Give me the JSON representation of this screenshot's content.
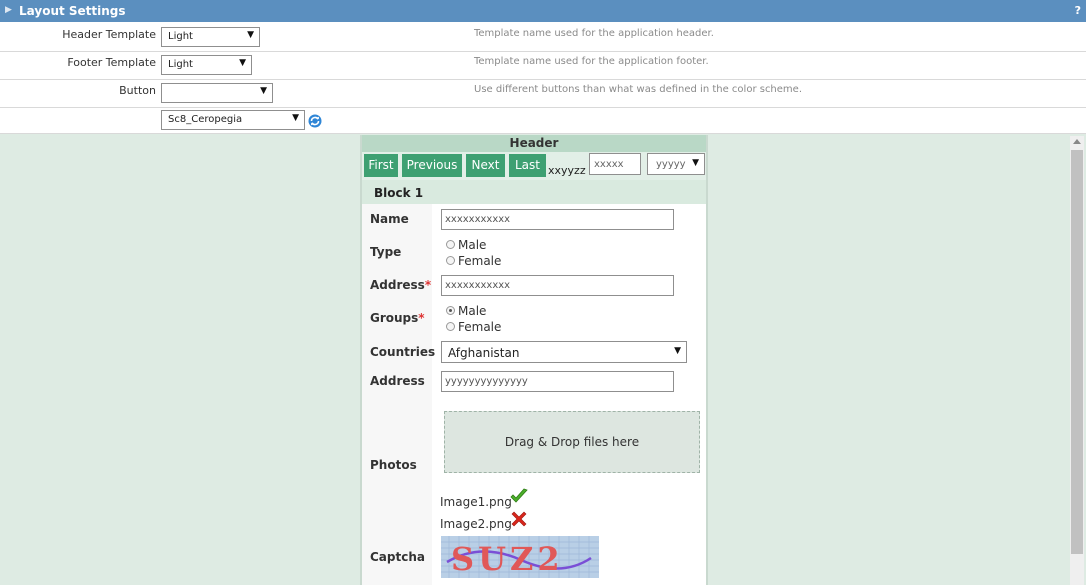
{
  "panel": {
    "title": "Layout Settings",
    "help": "?"
  },
  "settings": {
    "header_template": {
      "label": "Header Template",
      "value": "Light",
      "description": "Template name used for the application header."
    },
    "footer_template": {
      "label": "Footer Template",
      "value": "Light",
      "description": "Template name used for the application footer."
    },
    "button": {
      "label": "Button",
      "value": "",
      "description": "Use different buttons than what was defined in the color scheme."
    },
    "theme": {
      "value": "Sc8_Ceropegia"
    }
  },
  "preview": {
    "header": "Header",
    "nav": {
      "first": "First",
      "previous": "Previous",
      "next": "Next",
      "last": "Last",
      "page_text": "xxyyzz",
      "page_input": "xxxxx",
      "page_select": "yyyyy"
    },
    "block_title": "Block 1",
    "fields": {
      "name": {
        "label": "Name",
        "value": "xxxxxxxxxxx"
      },
      "type": {
        "label": "Type",
        "options": [
          "Male",
          "Female"
        ]
      },
      "address": {
        "label": "Address",
        "required": "*",
        "value": "xxxxxxxxxxx"
      },
      "groups": {
        "label": "Groups",
        "required": "*",
        "options": [
          "Male",
          "Female"
        ]
      },
      "countries": {
        "label": "Countries",
        "value": "Afghanistan"
      },
      "address2": {
        "label": "Address",
        "value": "yyyyyyyyyyyyyy"
      },
      "photos": {
        "label": "Photos",
        "dropzone": "Drag & Drop files here",
        "files": [
          "Image1.png",
          "Image2.png"
        ]
      },
      "captcha": {
        "label": "Captcha",
        "text": "SUZ2"
      }
    }
  },
  "colors": {
    "topbar": "#5b8fbf",
    "canvas": "#deebe3",
    "button": "#3ea072",
    "check": "#4caf2a",
    "error": "#d9261c"
  }
}
